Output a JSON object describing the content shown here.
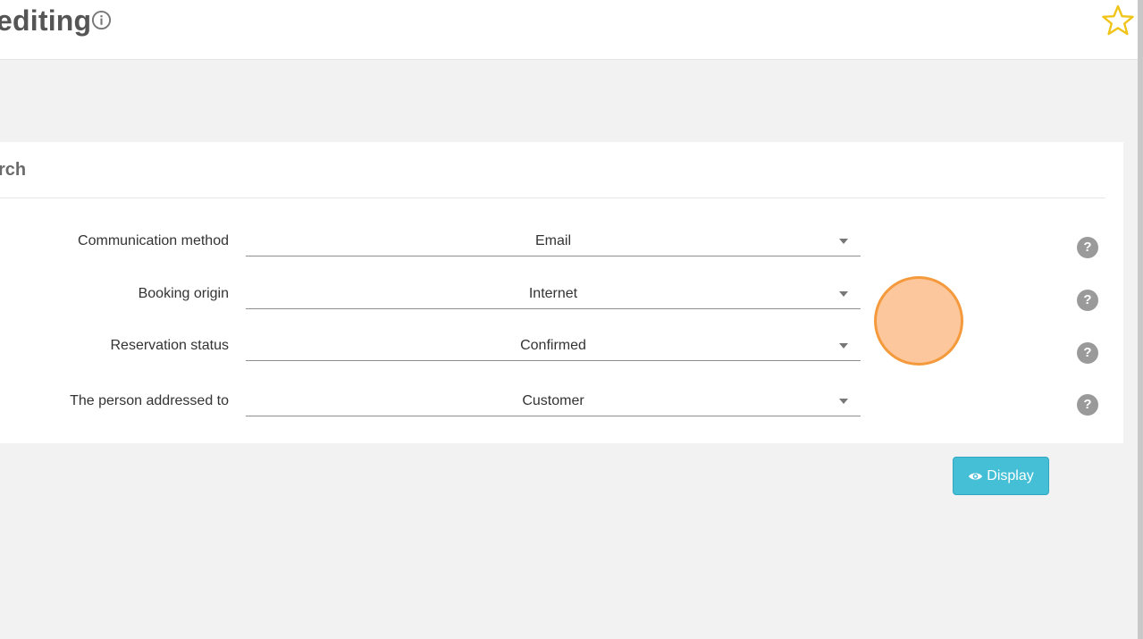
{
  "header": {
    "title": "editing",
    "info_icon": "info-icon",
    "favorite_icon": "star-icon",
    "favorite_color": "#f0c419"
  },
  "search_card": {
    "title": "rch",
    "fields": [
      {
        "label": "Communication method",
        "value": "Email"
      },
      {
        "label": "Booking origin",
        "value": "Internet"
      },
      {
        "label": "Reservation status",
        "value": "Confirmed"
      },
      {
        "label": "The person addressed to",
        "value": "Customer"
      }
    ],
    "help_glyph": "?"
  },
  "actions": {
    "display_label": "Display",
    "display_icon": "eye-icon",
    "accent_color": "#45bfd6"
  },
  "click_marker_color": "#fdc79d"
}
